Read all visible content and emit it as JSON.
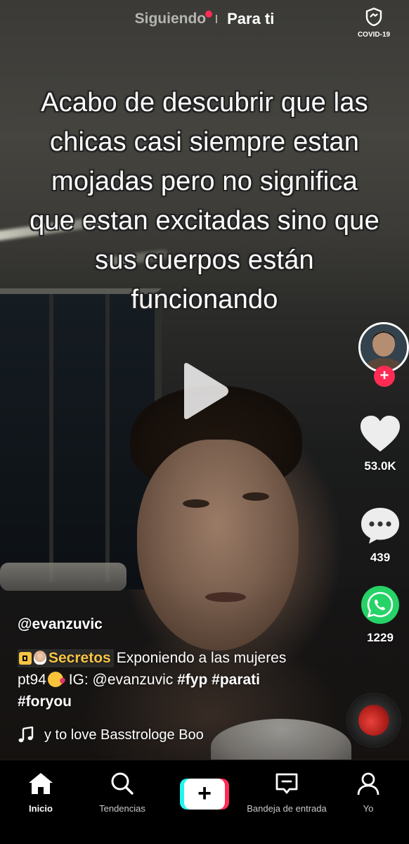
{
  "top_nav": {
    "following_label": "Siguiendo",
    "for_you_label": "Para ti",
    "covid_label": "COVID-19"
  },
  "video": {
    "caption": "Acabo de descubrir que las chicas casi siempre estan mojadas pero no significa que estan excitadas sino que sus cuerpos están funcionando"
  },
  "actions": {
    "likes": "53.0K",
    "comments": "439",
    "shares": "1229",
    "follow_symbol": "+"
  },
  "post": {
    "username": "@evanzuvic",
    "tag_label": "Secretos",
    "description_part1": "Exponiendo a las mujeres pt94",
    "description_part2": "IG: @evanzuvic",
    "hashtags": [
      "#fyp",
      "#parati",
      "#foryou"
    ]
  },
  "music": {
    "track": "y to love Basstrologe Boo"
  },
  "bottom_nav": {
    "items": [
      {
        "label": "Inicio",
        "icon": "home-icon"
      },
      {
        "label": "Tendencias",
        "icon": "search-icon"
      },
      {
        "label": "",
        "icon": "create-icon"
      },
      {
        "label": "Bandeja de entrada",
        "icon": "inbox-icon"
      },
      {
        "label": "Yo",
        "icon": "profile-icon"
      }
    ],
    "create_symbol": "+"
  },
  "colors": {
    "accent": "#fe2c55",
    "cyan": "#25f4ee",
    "tag_yellow": "#f6c343",
    "whatsapp": "#25d366"
  }
}
